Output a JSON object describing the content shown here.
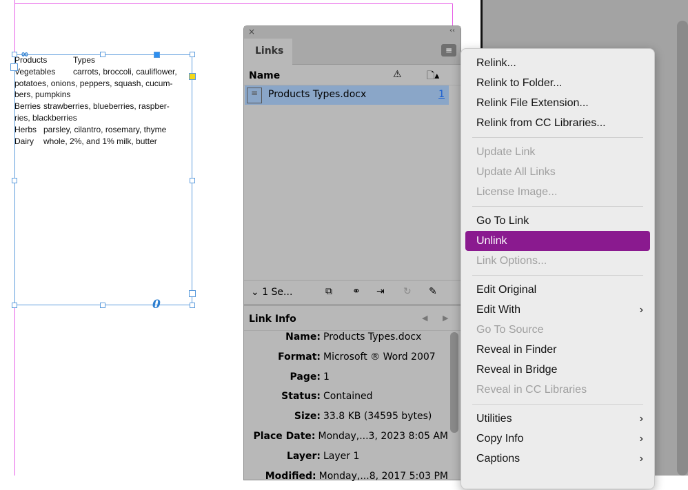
{
  "document": {
    "table_rows": [
      {
        "product": "Products",
        "types": "Types"
      },
      {
        "product": "Vegetables",
        "types": "carrots, broccoli, cauliflower,"
      },
      {
        "product": "",
        "types": "potatoes, onions, peppers, squash, cucum-"
      },
      {
        "product": "",
        "types": "bers, pumpkins"
      },
      {
        "product": "Berries",
        "types": "strawberries, blueberries, raspber-"
      },
      {
        "product": "",
        "types": "ries, blackberries"
      },
      {
        "product": "Herbs",
        "types": "parsley, cilantro, rosemary, thyme"
      },
      {
        "product": "Dairy",
        "types": "whole, 2%, and 1% milk, butter"
      }
    ]
  },
  "panel": {
    "close": "×",
    "collapse": "‹‹",
    "tab": "Links",
    "menu_icon": "hamburger-icon",
    "name_header": "Name",
    "link": {
      "name": "Products Types.docx",
      "page": "1"
    },
    "selection_label": "1 Se...",
    "link_info_title": "Link Info",
    "info": [
      {
        "k": "Name:",
        "v": "Products Types.docx"
      },
      {
        "k": "Format:",
        "v": "Microsoft ® Word 2007"
      },
      {
        "k": "Page:",
        "v": "1"
      },
      {
        "k": "Status:",
        "v": "Contained"
      },
      {
        "k": "Size:",
        "v": "33.8 KB (34595 bytes)"
      },
      {
        "k": "Place Date:",
        "v": "Monday,...3, 2023 8:05 AM"
      },
      {
        "k": "Layer:",
        "v": "Layer 1"
      },
      {
        "k": "Modified:",
        "v": "Monday,...8, 2017 5:03 PM"
      }
    ]
  },
  "menu": {
    "items": [
      {
        "label": "Relink...",
        "state": "enabled"
      },
      {
        "label": "Relink to Folder...",
        "state": "enabled"
      },
      {
        "label": "Relink File Extension...",
        "state": "enabled"
      },
      {
        "label": "Relink from CC Libraries...",
        "state": "enabled"
      },
      {
        "label": "Update Link",
        "state": "disabled"
      },
      {
        "label": "Update All Links",
        "state": "disabled"
      },
      {
        "label": "License Image...",
        "state": "disabled"
      },
      {
        "label": "Go To Link",
        "state": "enabled"
      },
      {
        "label": "Unlink",
        "state": "highlighted"
      },
      {
        "label": "Link Options...",
        "state": "disabled"
      },
      {
        "label": "Edit Original",
        "state": "enabled"
      },
      {
        "label": "Edit With",
        "state": "enabled",
        "submenu": true
      },
      {
        "label": "Go To Source",
        "state": "disabled"
      },
      {
        "label": "Reveal in Finder",
        "state": "enabled"
      },
      {
        "label": "Reveal in Bridge",
        "state": "enabled"
      },
      {
        "label": "Reveal in CC Libraries",
        "state": "disabled"
      },
      {
        "label": "Utilities",
        "state": "enabled",
        "submenu": true
      },
      {
        "label": "Copy Info",
        "state": "enabled",
        "submenu": true
      },
      {
        "label": "Captions",
        "state": "enabled",
        "submenu": true
      }
    ],
    "separators_after": [
      3,
      6,
      9,
      15
    ],
    "highlight_color": "#8a1a8f"
  }
}
